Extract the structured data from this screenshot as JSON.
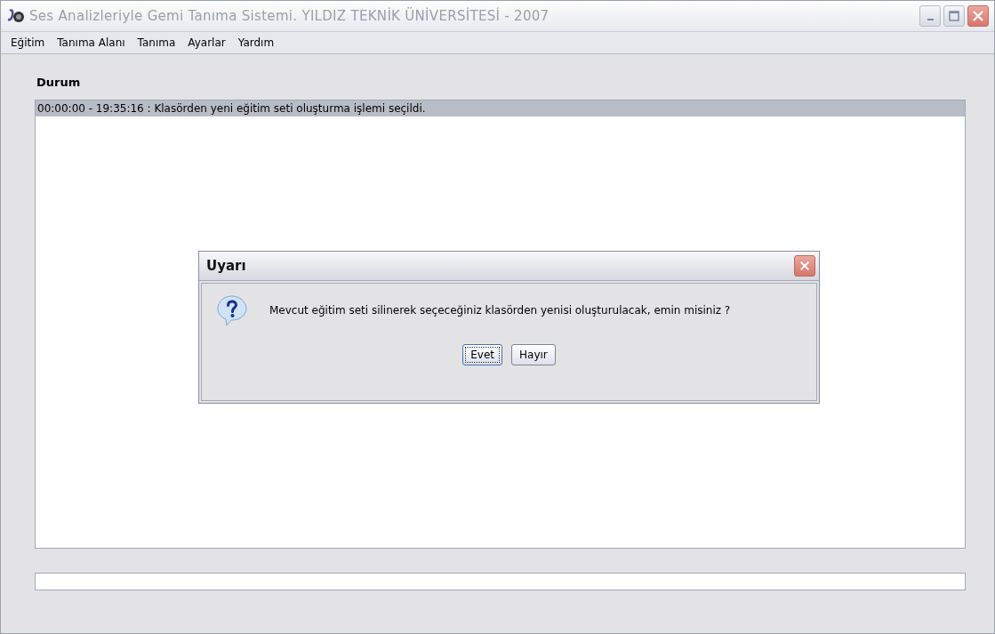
{
  "window": {
    "title": "Ses Analizleriyle Gemi Tanıma Sistemi. YILDIZ TEKNİK ÜNİVERSİTESİ - 2007"
  },
  "menu": [
    "Eğitim",
    "Tanıma Alanı",
    "Tanıma",
    "Ayarlar",
    "Yardım"
  ],
  "status": {
    "label": "Durum",
    "entries": [
      {
        "text": "00:00:00 - 19:35:16 : Klasörden yeni eğitim seti oluşturma işlemi seçildi.",
        "selected": true
      }
    ]
  },
  "dialog": {
    "title": "Uyarı",
    "message": "Mevcut eğitim seti silinerek seçeceğiniz klasörden yenisi oluşturulacak, emin misiniz ?",
    "buttons": [
      {
        "label": "Evet",
        "selected": true
      },
      {
        "label": "Hayır",
        "selected": false
      }
    ]
  }
}
